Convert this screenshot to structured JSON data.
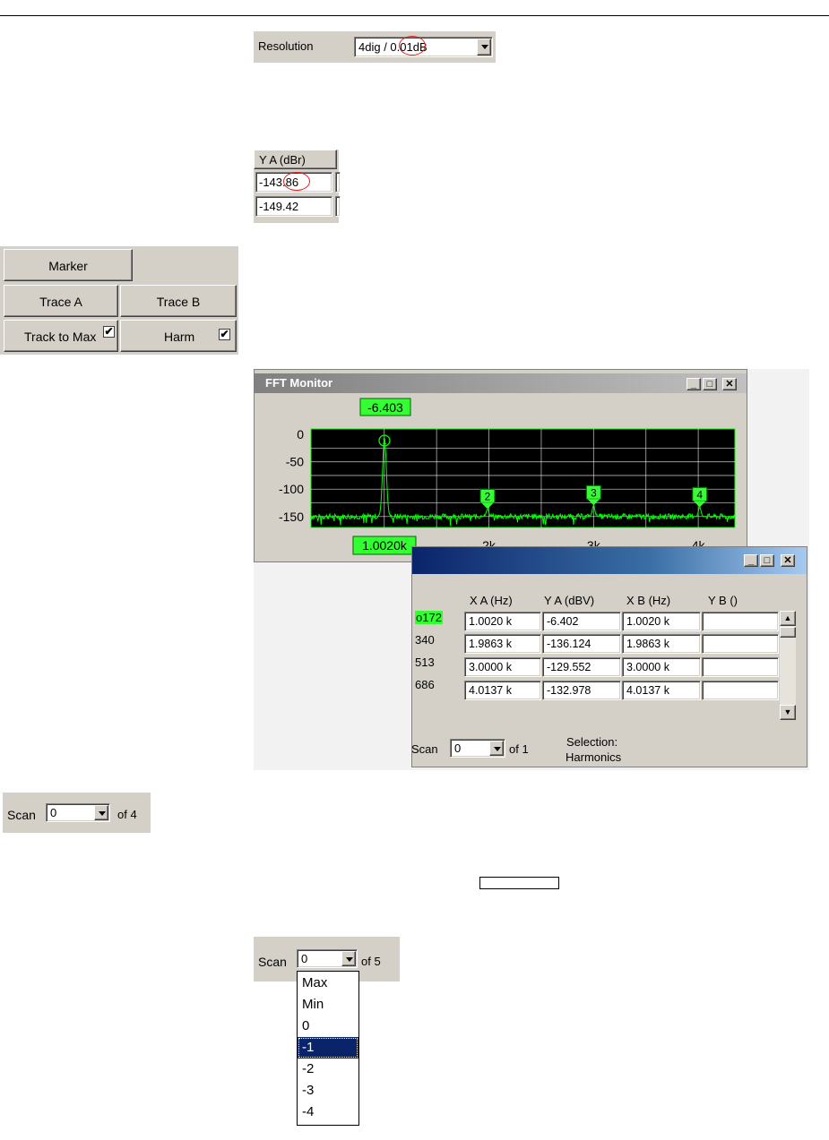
{
  "resolution": {
    "label": "Resolution",
    "value": "4dig / 0.01dB"
  },
  "ya_column": {
    "header": "Y A (dBr)",
    "values": [
      "-143.86",
      "-149.42"
    ]
  },
  "marker_panel": {
    "marker_label": "Marker",
    "trace_a_label": "Trace A",
    "trace_b_label": "Trace B",
    "track_label": "Track to Max",
    "harm_label": "Harm",
    "check_mark": "✔"
  },
  "fft": {
    "title": "FFT Monitor",
    "marker_value": "-6.403",
    "marker_freq": "1.0020k",
    "markers": [
      "1",
      "2",
      "3",
      "4"
    ],
    "y_ticks": [
      "0",
      "-50",
      "-100",
      "-150"
    ],
    "x_ticks": [
      "2k",
      "3k",
      "4k"
    ],
    "accent": "#00ff00"
  },
  "chart_data": {
    "type": "line",
    "title": "FFT Monitor",
    "xlabel": "",
    "ylabel": "",
    "xlim": [
      300,
      4350
    ],
    "ylim": [
      -170,
      10
    ],
    "y_ticks": [
      0,
      -50,
      -100,
      -150
    ],
    "x_ticks": [
      2000,
      3000,
      4000
    ],
    "harmonics": [
      {
        "x": 1002,
        "y": -6.403
      },
      {
        "x": 1986.3,
        "y": -136.124
      },
      {
        "x": 3000,
        "y": -129.552
      },
      {
        "x": 4013.7,
        "y": -132.978
      }
    ],
    "noise_floor": -150,
    "grid": true
  },
  "harmonics_table": {
    "headers": [
      "X A (Hz)",
      "Y A (dBV)",
      "X B (Hz)",
      "Y B ()"
    ],
    "rows": [
      {
        "idx": "o172",
        "xa": "1.0020 k",
        "ya": "-6.402",
        "xb": "1.0020 k",
        "yb": ""
      },
      {
        "idx": "340",
        "xa": "1.9863 k",
        "ya": "-136.124",
        "xb": "1.9863 k",
        "yb": ""
      },
      {
        "idx": "513",
        "xa": "3.0000 k",
        "ya": "-129.552",
        "xb": "3.0000 k",
        "yb": ""
      },
      {
        "idx": "686",
        "xa": "4.0137 k",
        "ya": "-132.978",
        "xb": "4.0137 k",
        "yb": ""
      }
    ],
    "scan_label": "Scan",
    "scan_value": "0",
    "scan_of": "of 1",
    "selection_label": "Selection:",
    "selection_value": "Harmonics"
  },
  "scan4": {
    "label": "Scan",
    "value": "0",
    "of": "of 4"
  },
  "scan5": {
    "label": "Scan",
    "value": "0",
    "of": "of 5",
    "options": [
      "Max",
      "Min",
      "0",
      "-1",
      "-2",
      "-3",
      "-4"
    ],
    "selected_index": 3
  },
  "colors": {
    "panel": "#d4d0c8",
    "title_active": "#0a246a",
    "highlight": "#0a246a",
    "trace": "#00ff00"
  }
}
